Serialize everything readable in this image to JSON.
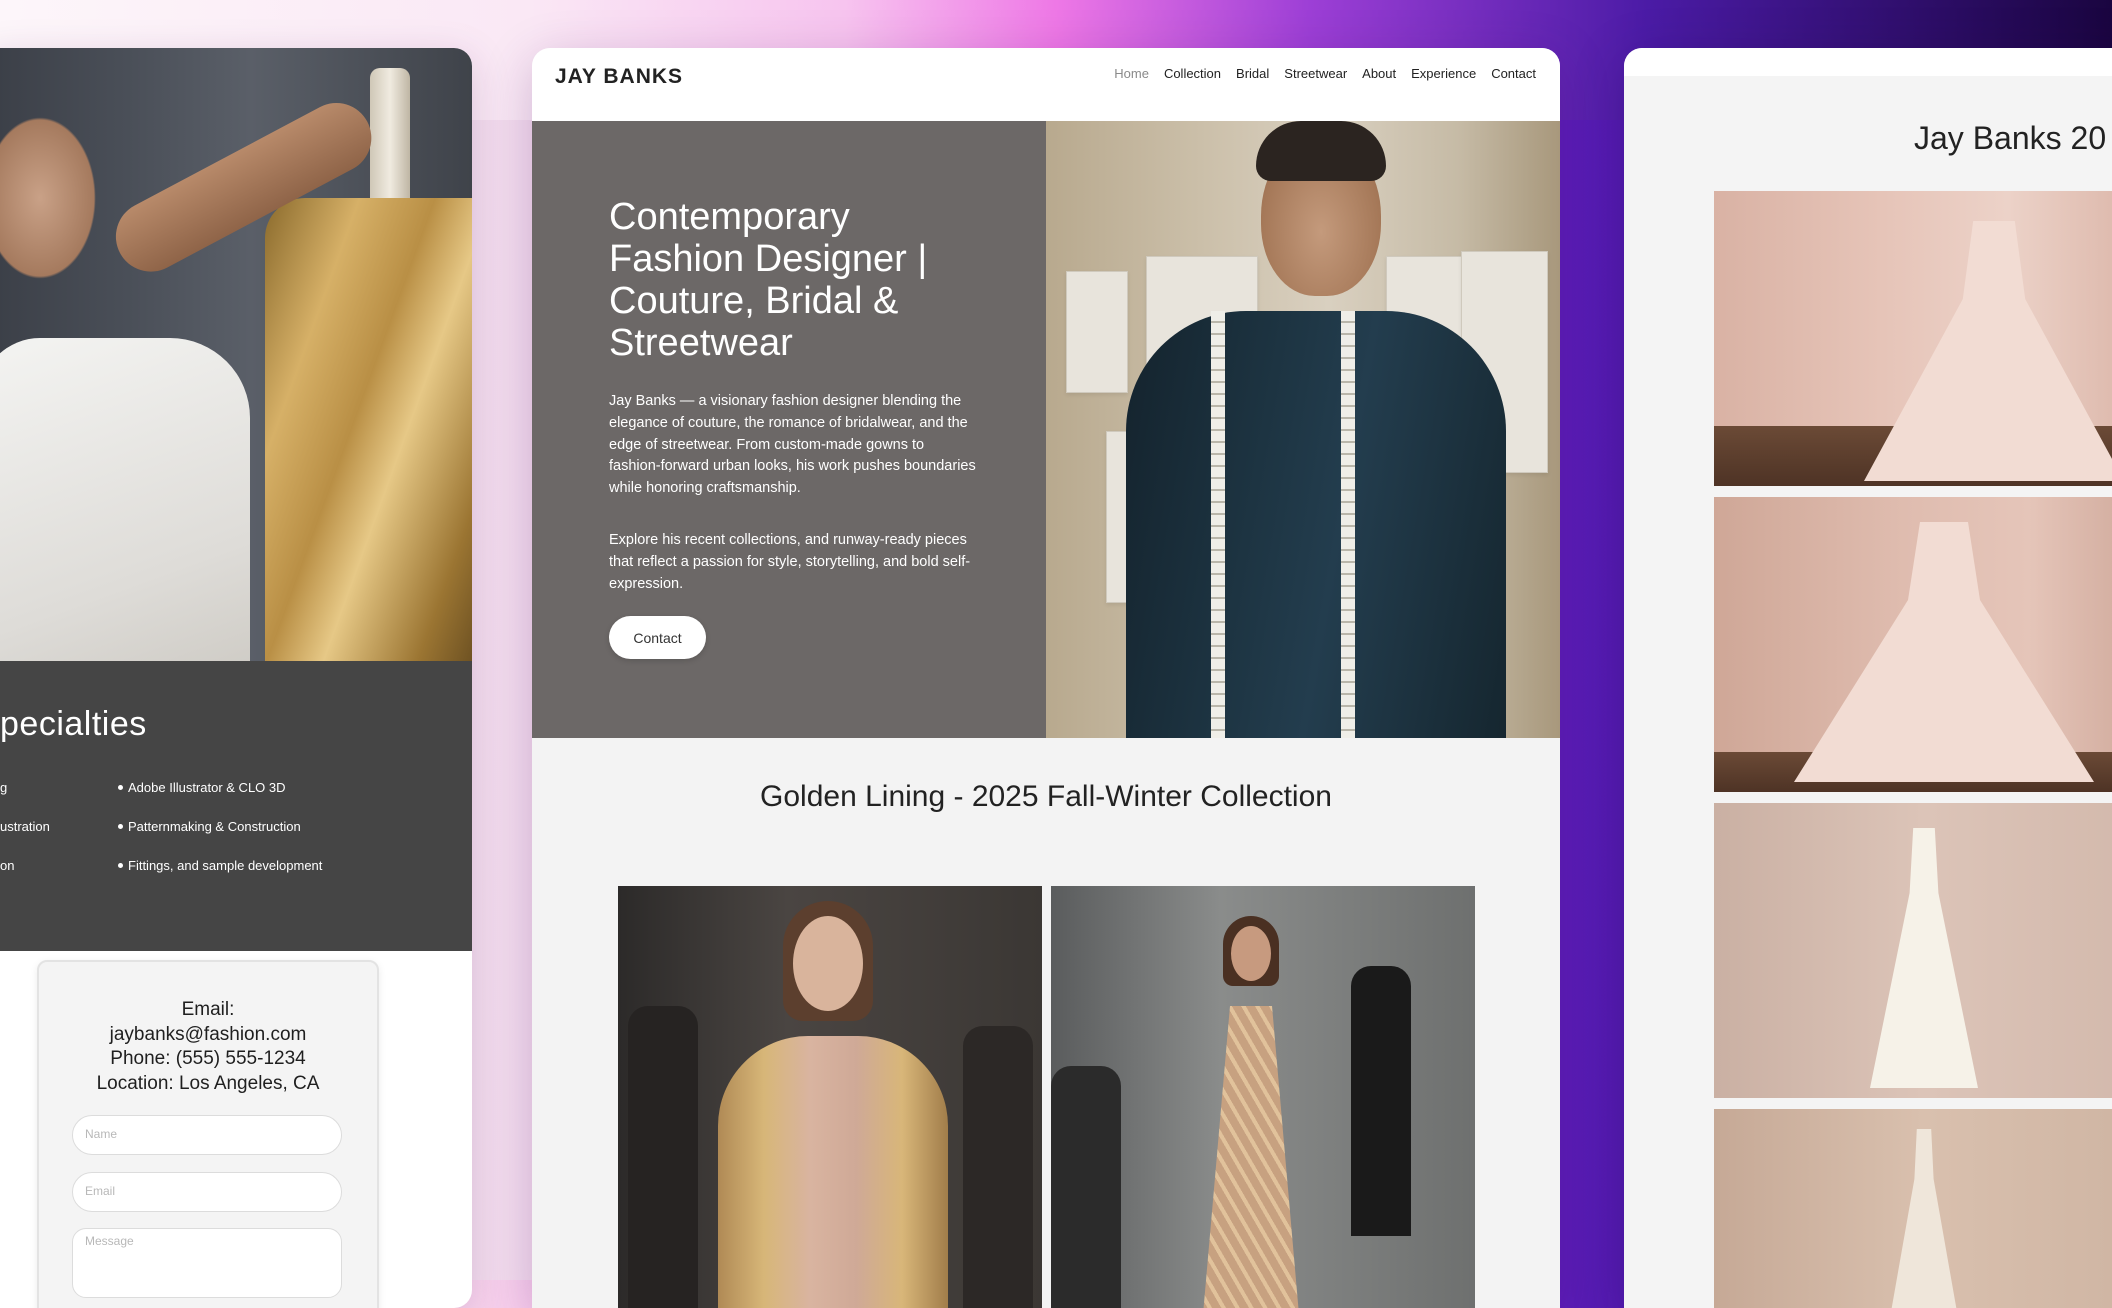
{
  "left_card": {
    "specialties_title": "pecialties",
    "col1": [
      "g",
      "ustration",
      "on"
    ],
    "col2": [
      "Adobe Illustrator & CLO 3D",
      "Patternmaking & Construction",
      "Fittings, and sample development"
    ],
    "contact": {
      "email_label": "Email:",
      "email": "jaybanks@fashion.com",
      "phone": "Phone: (555) 555-1234",
      "location": "Location: Los Angeles, CA"
    },
    "form": {
      "name_placeholder": "Name",
      "email_placeholder": "Email",
      "message_placeholder": "Message"
    }
  },
  "site": {
    "brand": "JAY BANKS",
    "nav": [
      "Home",
      "Collection",
      "Bridal",
      "Streetwear",
      "About",
      "Experience",
      "Contact"
    ],
    "active_nav": "Home"
  },
  "hero": {
    "title": "Contemporary Fashion Designer | Couture, Bridal & Streetwear",
    "p1": "Jay Banks — a visionary fashion designer blending the elegance of couture, the romance of bridalwear, and the edge of streetwear. From custom-made gowns to fashion-forward urban looks, his work pushes boundaries while honoring craftsmanship.",
    "p2": "Explore his recent collections, and runway-ready pieces that reflect a passion for style, storytelling, and bold self-expression.",
    "button": "Contact"
  },
  "collection": {
    "title": "Golden Lining - 2025 Fall-Winter Collection"
  },
  "right_card": {
    "title": "Jay Banks 20"
  },
  "colors": {
    "hero_bg": "#6c6867",
    "specialties_bg": "#454545",
    "accent_purple": "#4818a8",
    "accent_pink": "#e06be0"
  }
}
